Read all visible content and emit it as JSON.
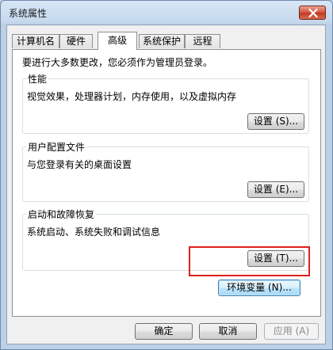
{
  "window": {
    "title": "系统属性",
    "close_icon": "close-icon"
  },
  "tabs": [
    {
      "label": "计算机名",
      "active": false
    },
    {
      "label": "硬件",
      "active": false
    },
    {
      "label": "高级",
      "active": true
    },
    {
      "label": "系统保护",
      "active": false
    },
    {
      "label": "远程",
      "active": false
    }
  ],
  "advanced": {
    "intro": "要进行大多数更改，您必须作为管理员登录。",
    "performance": {
      "title": "性能",
      "description": "视觉效果，处理器计划，内存使用，以及虚拟内存",
      "button": "设置 (S)..."
    },
    "user_profiles": {
      "title": "用户配置文件",
      "description": "与您登录有关的桌面设置",
      "button": "设置 (E)..."
    },
    "startup_recovery": {
      "title": "启动和故障恢复",
      "description": "系统启动、系统失败和调试信息",
      "button": "设置 (T)..."
    },
    "env_button": "环境变量 (N)..."
  },
  "footer": {
    "ok": "确定",
    "cancel": "取消",
    "apply": "应用 (A)"
  },
  "colors": {
    "highlight": "#e0201c"
  }
}
